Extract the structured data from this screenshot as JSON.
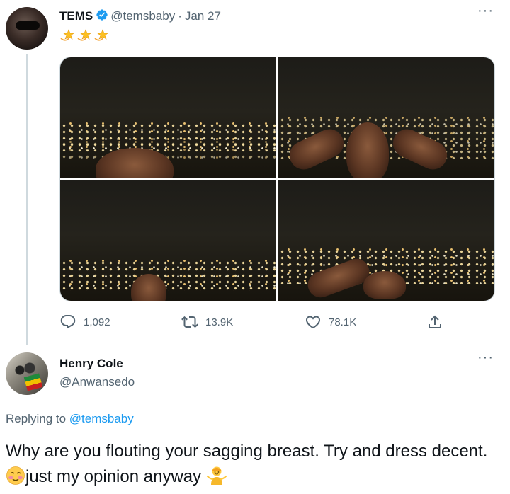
{
  "tweet": {
    "author_name": "TEMS",
    "author_handle": "@temsbaby",
    "separator": "·",
    "date": "Jan 27",
    "body_emoji_icons": [
      "dizzy-star-icon",
      "dizzy-star-icon",
      "dizzy-star-icon"
    ],
    "more_label": "···",
    "media_count": 4,
    "stats": {
      "replies": "1,092",
      "retweets": "13.9K",
      "likes": "78.1K"
    }
  },
  "reply": {
    "author_name": "Henry Cole",
    "author_handle": "@Anwansedo",
    "more_label": "···",
    "replying_prefix": "Replying to",
    "replying_handle": "@temsbaby",
    "text_part1": "Why are you flouting your sagging breast. Try and dress decent.",
    "text_part2": "just my opinion anyway",
    "emoji_icons": [
      "smiling-face-with-hearts-blush-icon",
      "person-shrugging-icon"
    ]
  },
  "colors": {
    "text": "#0f1419",
    "secondary": "#536471",
    "accent": "#1d9bf0",
    "border": "#cfd9de"
  }
}
